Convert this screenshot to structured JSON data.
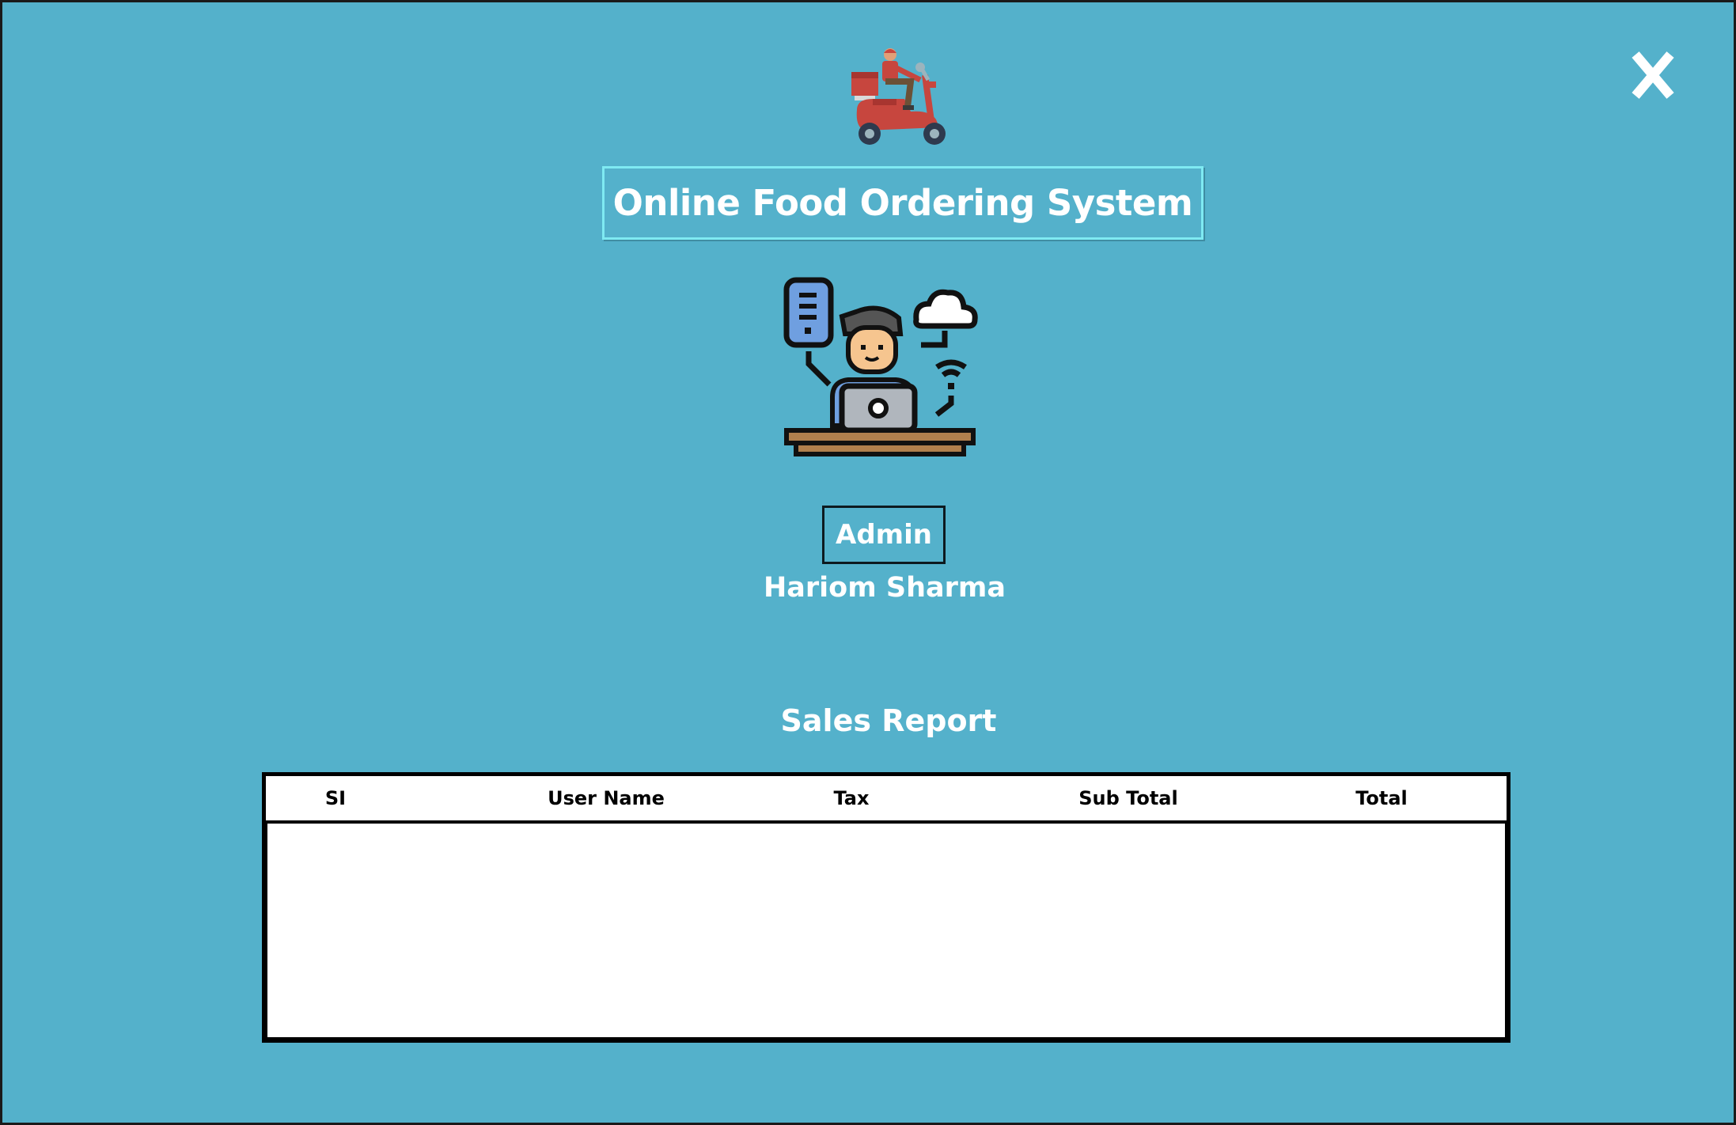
{
  "window": {
    "close_label": "X",
    "background_color": "#54b1cb"
  },
  "header": {
    "logo_icon": "delivery-scooter-icon",
    "title": "Online Food Ordering System"
  },
  "profile": {
    "illustration_icon": "admin-at-laptop-icon",
    "role": "Admin",
    "name": "Hariom Sharma"
  },
  "report": {
    "title": "Sales Report",
    "columns": [
      "SI",
      "User Name",
      "Tax",
      "Sub Total",
      "Total"
    ],
    "rows": []
  }
}
